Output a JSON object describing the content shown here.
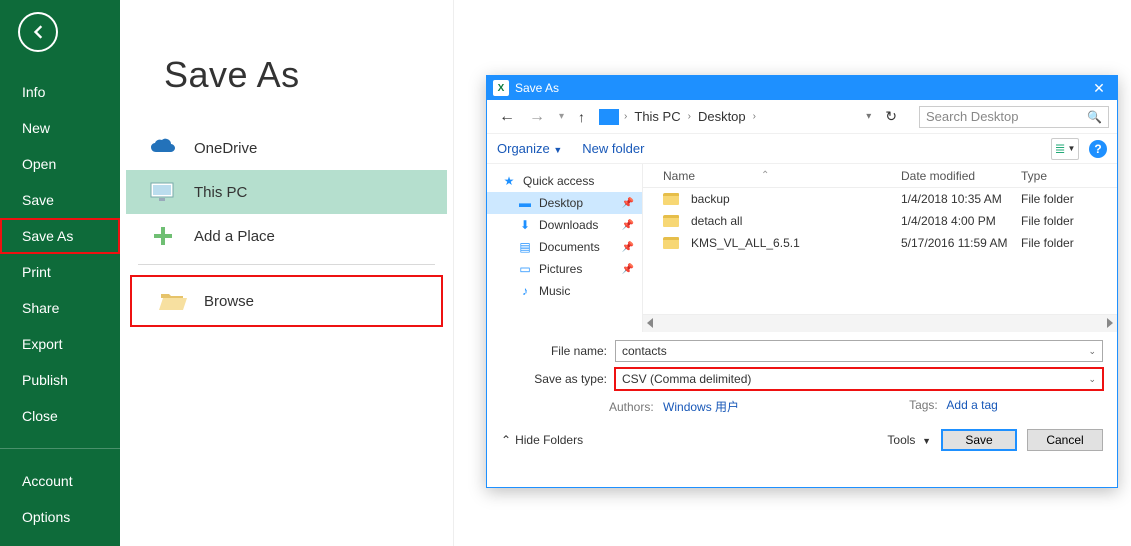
{
  "sidebar": {
    "items": [
      "Info",
      "New",
      "Open",
      "Save",
      "Save As",
      "Print",
      "Share",
      "Export",
      "Publish",
      "Close"
    ],
    "bottom": [
      "Account",
      "Options"
    ],
    "selected": "Save As"
  },
  "mid": {
    "title": "Save As",
    "onedrive": "OneDrive",
    "thispc": "This PC",
    "addplace": "Add a Place",
    "browse": "Browse"
  },
  "dialog": {
    "title": "Save As",
    "path": {
      "root": "This PC",
      "child": "Desktop"
    },
    "search_placeholder": "Search Desktop",
    "organize": "Organize",
    "newfolder": "New folder",
    "nav": {
      "quick": "Quick access",
      "desktop": "Desktop",
      "downloads": "Downloads",
      "documents": "Documents",
      "pictures": "Pictures",
      "music": "Music"
    },
    "cols": {
      "name": "Name",
      "date": "Date modified",
      "type": "Type"
    },
    "files": [
      {
        "name": "backup",
        "date": "1/4/2018 10:35 AM",
        "type": "File folder"
      },
      {
        "name": "detach all",
        "date": "1/4/2018 4:00 PM",
        "type": "File folder"
      },
      {
        "name": "KMS_VL_ALL_6.5.1",
        "date": "5/17/2016 11:59 AM",
        "type": "File folder"
      }
    ],
    "filename_label": "File name:",
    "filename": "contacts",
    "type_label": "Save as type:",
    "type": "CSV (Comma delimited)",
    "authors_label": "Authors:",
    "authors": "Windows 用户",
    "tags_label": "Tags:",
    "tags": "Add a tag",
    "hide": "Hide Folders",
    "tools": "Tools",
    "save": "Save",
    "cancel": "Cancel"
  }
}
